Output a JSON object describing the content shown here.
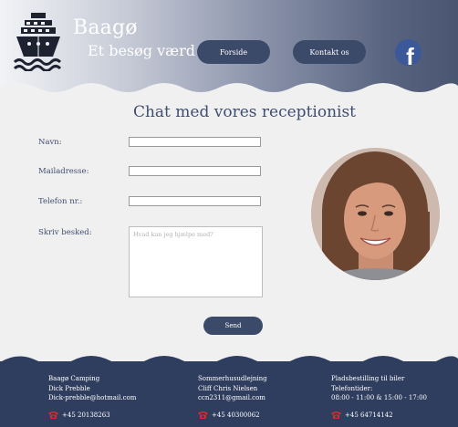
{
  "header": {
    "brand_title": "Baagø",
    "brand_subtitle": "Et besøg værd",
    "nav": [
      {
        "label": "Forside"
      },
      {
        "label": "Kontakt os"
      }
    ],
    "facebook_glyph": "f"
  },
  "form": {
    "title": "Chat med vores receptionist",
    "fields": {
      "name_label": "Navn:",
      "email_label": "Mailadresse:",
      "phone_label": "Telefon nr.:",
      "message_label": "Skriv besked:",
      "message_placeholder": "Hvad kan jeg hjælpe med?"
    },
    "send_label": "Send"
  },
  "footer": {
    "columns": [
      {
        "lines": [
          "Baagø Camping",
          "Dick Prebble",
          "Dick-prebble@hotmail.com"
        ],
        "phone": "+45 20138263"
      },
      {
        "lines": [
          "Sommerhusudlejning",
          "Cliff Chris Nielsen",
          "ccn2311@gmail.com"
        ],
        "phone": "+45 40300062"
      },
      {
        "lines": [
          "Pladsbestilling til biler",
          "Telefontider:",
          "08:00 - 11:00 & 15:00 - 17:00"
        ],
        "phone": "+45 64714142"
      }
    ]
  },
  "colors": {
    "navy": "#3c4a69",
    "footer_bg": "#2f3e5f",
    "page_bg": "#f0f0f0",
    "title_text": "#3f4d70",
    "phone_icon": "#d92a2a"
  },
  "icons": {
    "logo": "ship-icon",
    "social": "facebook-icon",
    "phone": "phone-icon"
  }
}
